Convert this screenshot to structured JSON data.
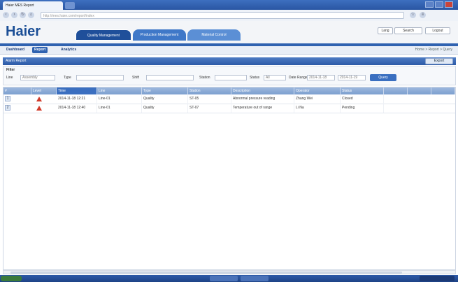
{
  "browser": {
    "tab_title": "Haier MES Report",
    "url": "http://mes.haier.com/report/index"
  },
  "header": {
    "logo": "Haier",
    "modules": [
      "Quality Management",
      "Production Management",
      "Material Control"
    ],
    "buttons": [
      "Lang",
      "Search",
      "Logout"
    ]
  },
  "subnav": {
    "items": [
      "Dashboard",
      "Report",
      "Analytics"
    ],
    "active_index": 1,
    "path": "Home > Report > Query"
  },
  "panel": {
    "title": "Alarm Report",
    "action": "Export"
  },
  "filter": {
    "section": "Filter",
    "labels": [
      "Line",
      "Type",
      "Shift",
      "Station",
      "Status",
      "Date Range"
    ],
    "values": [
      "Assembly",
      "",
      "",
      "",
      "All",
      "2014-11-18"
    ],
    "date_to": "2014-11-19",
    "search_button": "Query"
  },
  "grid": {
    "columns": [
      "#",
      "Level",
      "Time",
      "Line",
      "Type",
      "Station",
      "Description",
      "Operator",
      "Status",
      "",
      "",
      ""
    ],
    "rows": [
      {
        "num": "1",
        "time": "2014-11-18 12:21",
        "line": "Line-01",
        "type": "Quality",
        "station": "ST-05",
        "desc": "Abnormal pressure reading",
        "operator": "Zhang Wei",
        "status": "Closed"
      },
      {
        "num": "2",
        "time": "2014-11-18 12:40",
        "line": "Line-01",
        "type": "Quality",
        "station": "ST-07",
        "desc": "Temperature out of range",
        "operator": "Li Na",
        "status": "Pending"
      }
    ]
  },
  "colors": {
    "brand": "#1a4e96",
    "accent": "#2f62b0",
    "alert": "#d13b2b"
  }
}
